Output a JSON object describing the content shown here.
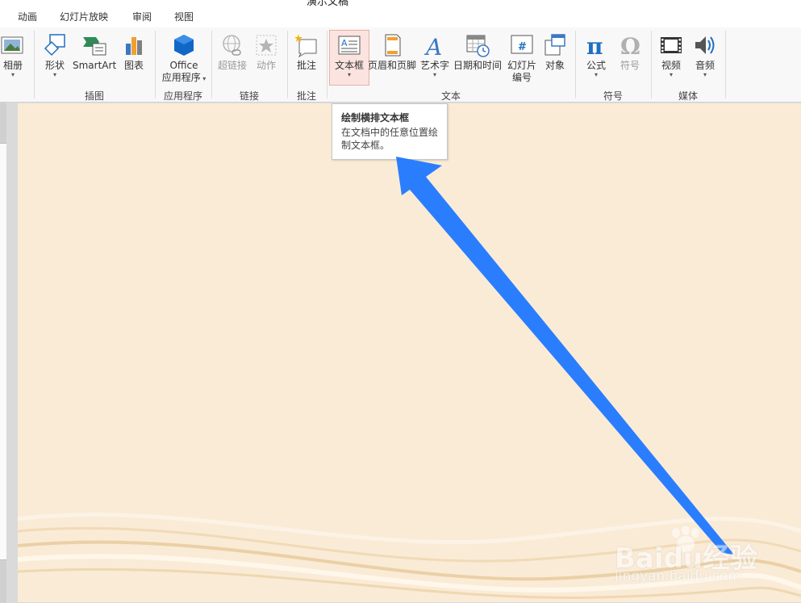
{
  "app": {
    "title_partial": "演示文稿"
  },
  "tabs": [
    "动画",
    "幻灯片放映",
    "审阅",
    "视图"
  ],
  "ribbon": {
    "buttons": {
      "album": "相册",
      "shapes": "形状",
      "smartart": "SmartArt",
      "chart": "图表",
      "office_line1": "Office",
      "office_line2": "应用程序",
      "hyperlink": "超链接",
      "action": "动作",
      "comment": "批注",
      "textbox": "文本框",
      "header_footer": "页眉和页脚",
      "wordart": "艺术字",
      "datetime": "日期和时间",
      "slidenum_line1": "幻灯片",
      "slidenum_line2": "编号",
      "object": "对象",
      "equation": "公式",
      "symbol": "符号",
      "video": "视频",
      "audio": "音频"
    },
    "groups": {
      "illustrations": "插图",
      "apps": "应用程序",
      "links": "链接",
      "comments": "批注",
      "text": "文本",
      "symbols": "符号",
      "media": "媒体"
    },
    "icons": {
      "datetime_icon_glyph": "#",
      "slidenum_icon_glyph": "#",
      "wordart_glyph": "A",
      "textbox_glyph": "A",
      "equation_glyph": "π",
      "symbol_glyph": "Ω"
    }
  },
  "tooltip": {
    "title": "绘制横排文本框",
    "description": "在文档中的任意位置绘制文本框。"
  },
  "watermark": {
    "brand": "Baidu经验",
    "url": "jingyan.baidu.com"
  },
  "colors": {
    "accent_arrow": "#1f78ff",
    "slide_background": "#faebd7",
    "office_blue": "#1167c6",
    "active_button": "#fbe4df"
  }
}
